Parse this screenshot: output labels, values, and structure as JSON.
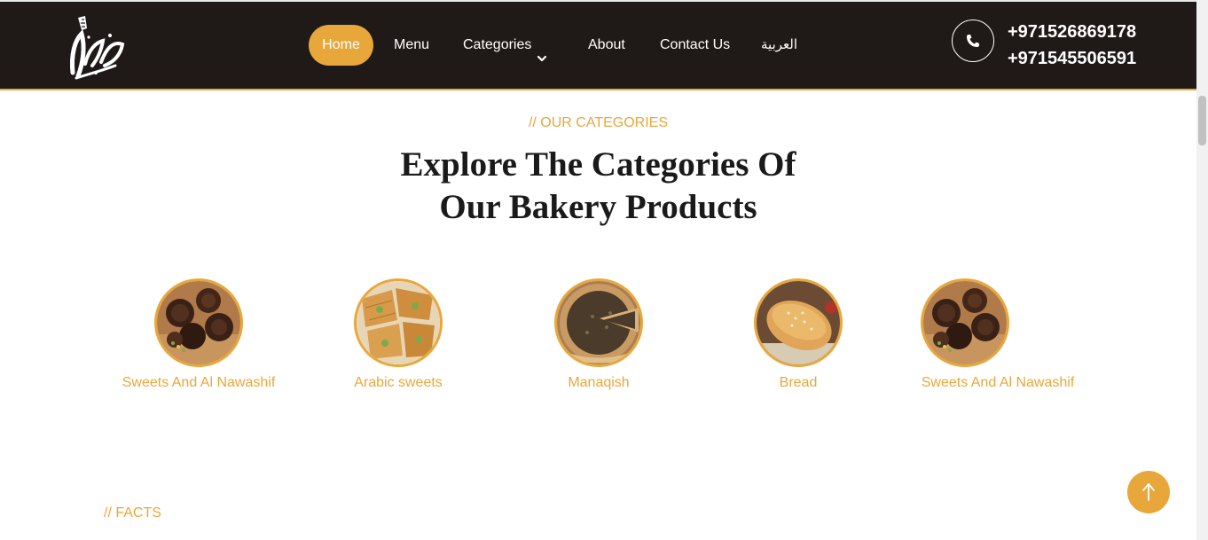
{
  "header": {
    "logo_text": "الكوفية",
    "nav": [
      {
        "label": "Home",
        "active": true
      },
      {
        "label": "Menu"
      },
      {
        "label": "Categories"
      },
      {
        "label": "About"
      },
      {
        "label": "Contact Us"
      },
      {
        "label": "العربية"
      }
    ],
    "phones": [
      "+971526869178",
      "+971545506591"
    ]
  },
  "categories_section": {
    "eyebrow": "// OUR CATEGORIES",
    "title_line1": "Explore The Categories Of",
    "title_line2": "Our Bakery Products",
    "items": [
      {
        "label": "Sweets And Al Nawashif",
        "image": "chocolate-sweets"
      },
      {
        "label": "Arabic sweets",
        "image": "baklava"
      },
      {
        "label": "Manaqish",
        "image": "manaqish"
      },
      {
        "label": "Bread",
        "image": "bread"
      },
      {
        "label": "Sweets And Al Nawashif",
        "image": "chocolate-sweets"
      }
    ]
  },
  "facts_section": {
    "eyebrow": "// FACTS"
  },
  "colors": {
    "accent": "#e8a73b",
    "header_bg": "#1f1a17",
    "heading": "#1a1a1a"
  }
}
